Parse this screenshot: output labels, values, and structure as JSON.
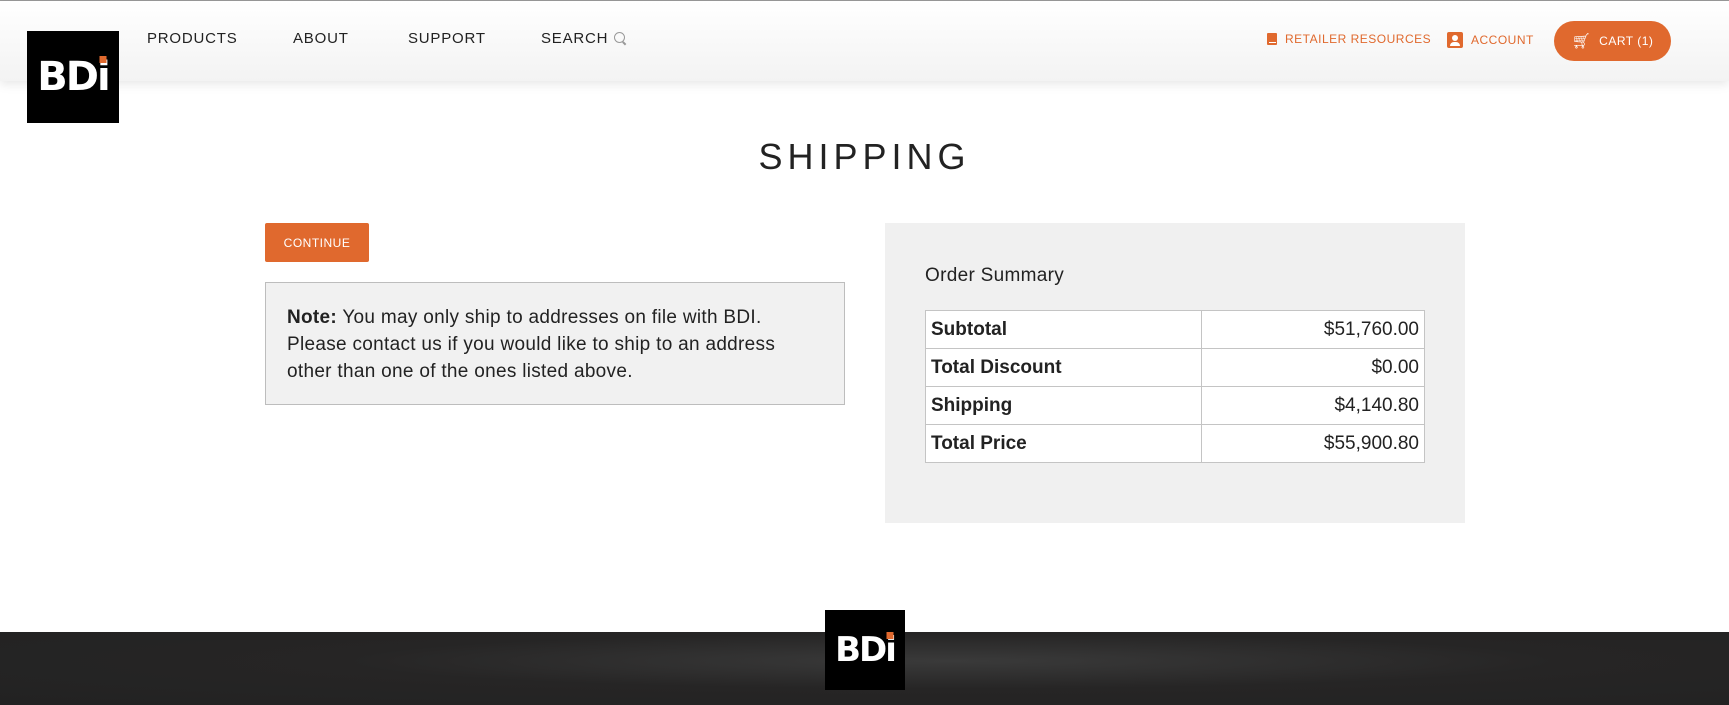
{
  "brand": {
    "logo_text_main": "BD",
    "logo_text_i": "i",
    "accent_color": "#e0692e"
  },
  "nav": {
    "products": "PRODUCTS",
    "about": "ABOUT",
    "support": "SUPPORT",
    "search": "SEARCH"
  },
  "utility": {
    "retailer_resources": "RETAILER RESOURCES",
    "account": "ACCOUNT",
    "cart": "CART (1)"
  },
  "page": {
    "title": "SHIPPING",
    "continue_label": "CONTINUE",
    "note_label": "Note:",
    "note_text": "You may only ship to addresses on file with BDI. Please contact us if you would like to ship to an address other than one of the ones listed above."
  },
  "order_summary": {
    "title": "Order Summary",
    "rows": [
      {
        "label": "Subtotal",
        "value": "$51,760.00"
      },
      {
        "label": "Total Discount",
        "value": "$0.00"
      },
      {
        "label": "Shipping",
        "value": "$4,140.80"
      },
      {
        "label": "Total Price",
        "value": "$55,900.80"
      }
    ]
  }
}
